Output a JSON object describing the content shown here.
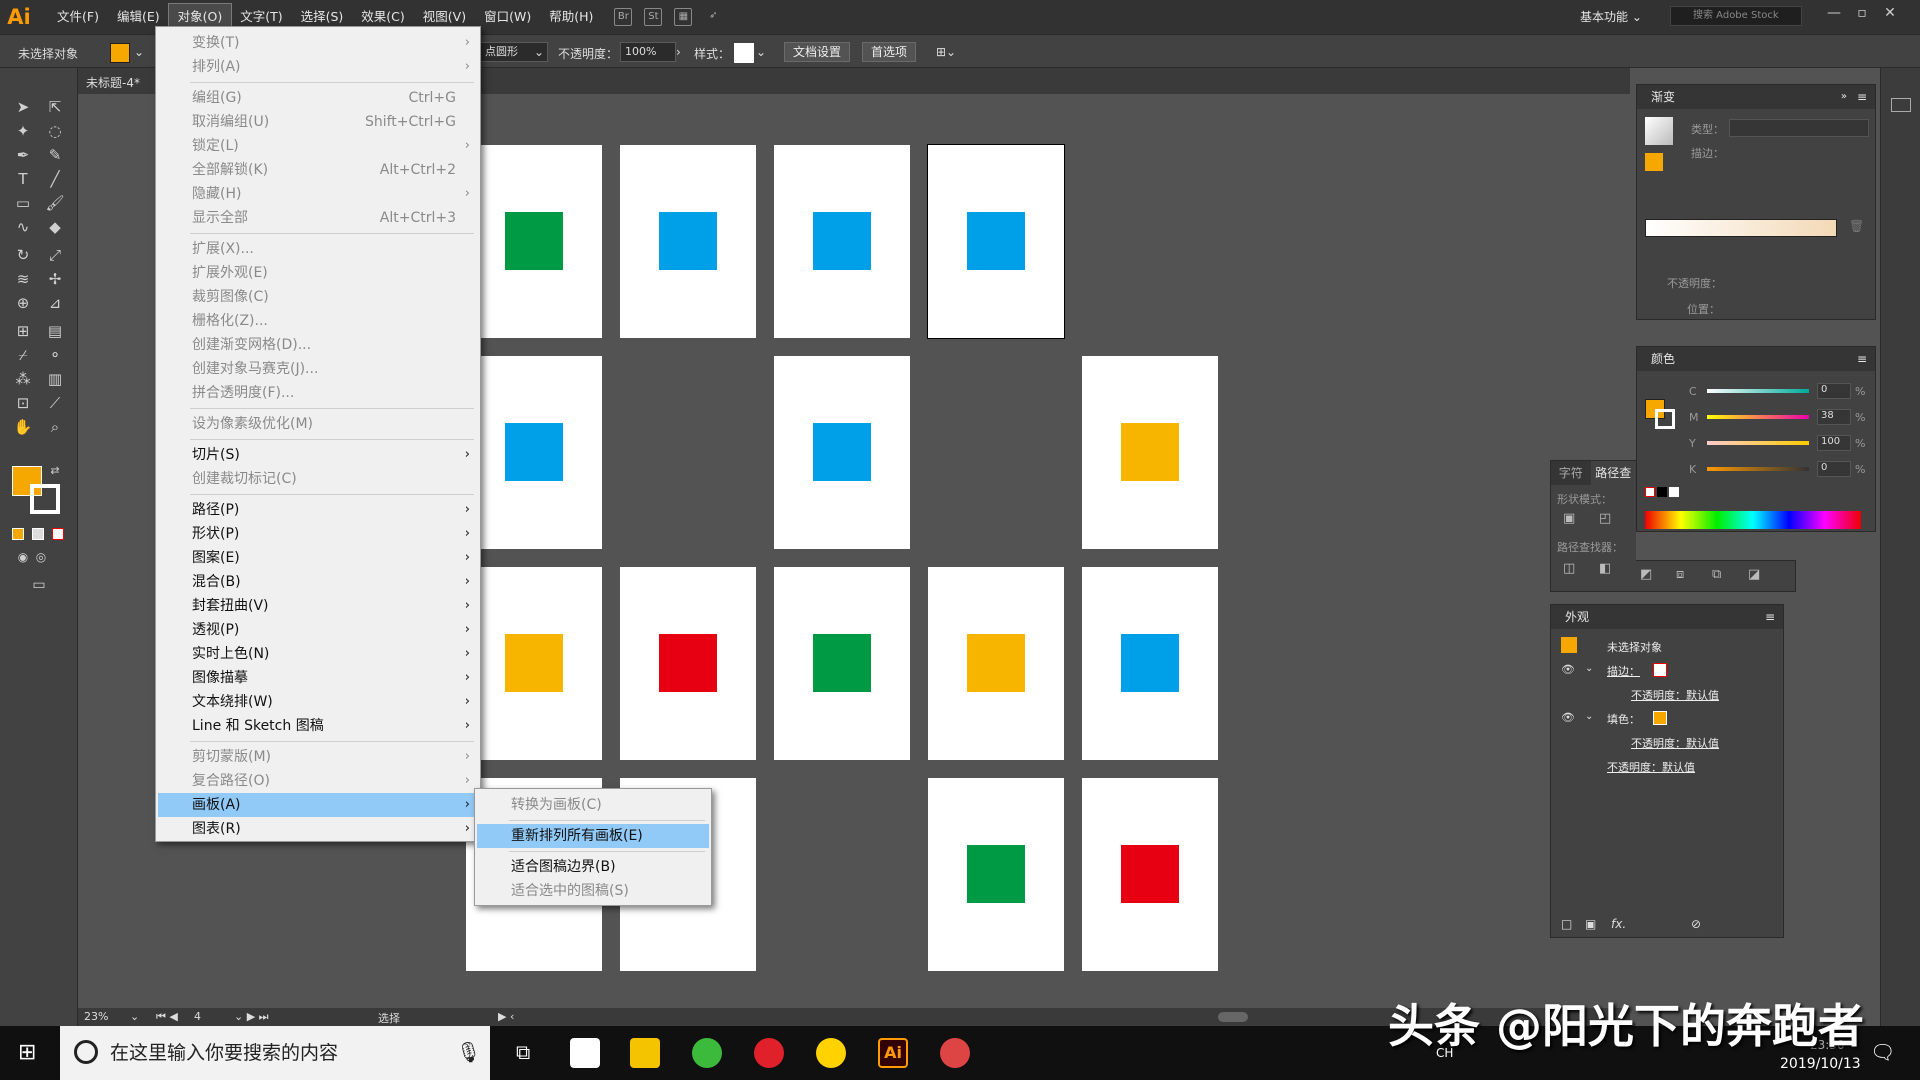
{
  "menubar": {
    "logo": "Ai",
    "items": [
      "文件(F)",
      "编辑(E)",
      "对象(O)",
      "文字(T)",
      "选择(S)",
      "效果(C)",
      "视图(V)",
      "窗口(W)",
      "帮助(H)"
    ],
    "workspace": "基本功能",
    "stock_placeholder": "搜索 Adobe Stock"
  },
  "control": {
    "no_selection": "未选择对象",
    "shape": "点圆形",
    "opacity_label": "不透明度：",
    "opacity": "100%",
    "style_label": "样式：",
    "doc_setup": "文档设置",
    "prefs": "首选项"
  },
  "document": {
    "tab": "未标题-4*"
  },
  "statusbar": {
    "zoom": "23%",
    "artboard": "4",
    "mode": "选择"
  },
  "colors": {
    "fill": "#f7a800",
    "green": "#009944",
    "blue": "#00a0e9",
    "orange": "#f8b500",
    "red": "#e60012"
  },
  "artboards": [
    {
      "id": "ab1",
      "square": "green"
    },
    {
      "id": "ab2",
      "square": "blue"
    },
    {
      "id": "ab3",
      "square": "blue"
    },
    {
      "id": "ab4",
      "square": "blue"
    },
    {
      "id": "ab5",
      "square": "blue"
    },
    {
      "id": "ab6",
      "square": "blue"
    },
    {
      "id": "ab7",
      "square": "orange"
    },
    {
      "id": "ab8",
      "square": "orange"
    },
    {
      "id": "ab9",
      "square": "red"
    },
    {
      "id": "ab10",
      "square": "green"
    },
    {
      "id": "ab11",
      "square": "orange"
    },
    {
      "id": "ab12",
      "square": "blue"
    },
    {
      "id": "ab13",
      "square": ""
    },
    {
      "id": "ab14",
      "square": ""
    },
    {
      "id": "ab15",
      "square": "green"
    },
    {
      "id": "ab16",
      "square": "red"
    }
  ],
  "object_menu": {
    "items": [
      {
        "label": "变换(T)",
        "arrow": true,
        "dis": true
      },
      {
        "label": "排列(A)",
        "arrow": true,
        "dis": true
      },
      {
        "sep": true
      },
      {
        "label": "编组(G)",
        "shortcut": "Ctrl+G",
        "dis": true
      },
      {
        "label": "取消编组(U)",
        "shortcut": "Shift+Ctrl+G",
        "dis": true
      },
      {
        "label": "锁定(L)",
        "arrow": true,
        "dis": true
      },
      {
        "label": "全部解锁(K)",
        "shortcut": "Alt+Ctrl+2",
        "dis": true
      },
      {
        "label": "隐藏(H)",
        "arrow": true,
        "dis": true
      },
      {
        "label": "显示全部",
        "shortcut": "Alt+Ctrl+3",
        "dis": true
      },
      {
        "sep": true
      },
      {
        "label": "扩展(X)...",
        "dis": true
      },
      {
        "label": "扩展外观(E)",
        "dis": true
      },
      {
        "label": "裁剪图像(C)",
        "dis": true
      },
      {
        "label": "栅格化(Z)...",
        "dis": true
      },
      {
        "label": "创建渐变网格(D)...",
        "dis": true
      },
      {
        "label": "创建对象马赛克(J)...",
        "dis": true
      },
      {
        "label": "拼合透明度(F)...",
        "dis": true
      },
      {
        "sep": true
      },
      {
        "label": "设为像素级优化(M)",
        "dis": true
      },
      {
        "sep": true
      },
      {
        "label": "切片(S)",
        "arrow": true
      },
      {
        "label": "创建裁切标记(C)",
        "dis": true
      },
      {
        "sep": true
      },
      {
        "label": "路径(P)",
        "arrow": true
      },
      {
        "label": "形状(P)",
        "arrow": true
      },
      {
        "label": "图案(E)",
        "arrow": true
      },
      {
        "label": "混合(B)",
        "arrow": true
      },
      {
        "label": "封套扭曲(V)",
        "arrow": true
      },
      {
        "label": "透视(P)",
        "arrow": true
      },
      {
        "label": "实时上色(N)",
        "arrow": true
      },
      {
        "label": "图像描摹",
        "arrow": true
      },
      {
        "label": "文本绕排(W)",
        "arrow": true
      },
      {
        "label": "Line 和 Sketch 图稿",
        "arrow": true
      },
      {
        "sep": true
      },
      {
        "label": "剪切蒙版(M)",
        "arrow": true,
        "dis": true
      },
      {
        "label": "复合路径(O)",
        "arrow": true,
        "dis": true
      },
      {
        "label": "画板(A)",
        "arrow": true,
        "hl": true
      },
      {
        "label": "图表(R)",
        "arrow": true
      }
    ]
  },
  "artboard_submenu": {
    "items": [
      {
        "label": "转换为画板(C)",
        "dis": true
      },
      {
        "sep": true
      },
      {
        "label": "重新排列所有画板(E)",
        "hl": true
      },
      {
        "sep": true
      },
      {
        "label": "适合图稿边界(B)"
      },
      {
        "label": "适合选中的图稿(S)",
        "dis": true
      }
    ]
  },
  "gradient_panel": {
    "title": "渐变",
    "type_label": "类型：",
    "stroke_label": "描边：",
    "opacity_label": "不透明度：",
    "position_label": "位置："
  },
  "color_panel": {
    "title": "颜色",
    "channels": [
      {
        "name": "C",
        "value": "0"
      },
      {
        "name": "M",
        "value": "38"
      },
      {
        "name": "Y",
        "value": "100"
      },
      {
        "name": "K",
        "value": "0"
      }
    ],
    "unit": "%"
  },
  "pathfinder_panel": {
    "tabs": [
      "字符",
      "路径查"
    ],
    "shape_modes": "形状模式：",
    "pathfinder": "路径查找器："
  },
  "appearance_panel": {
    "title": "外观",
    "no_selection": "未选择对象",
    "stroke": "描边：",
    "fill": "填色：",
    "opacity_default": "不透明度：默认值"
  },
  "taskbar": {
    "search_placeholder": "在这里输入你要搜索的内容",
    "time": "23:50",
    "date": "2019/10/13",
    "ime": "CH"
  },
  "watermark": "头条 @阳光下的奔跑者"
}
